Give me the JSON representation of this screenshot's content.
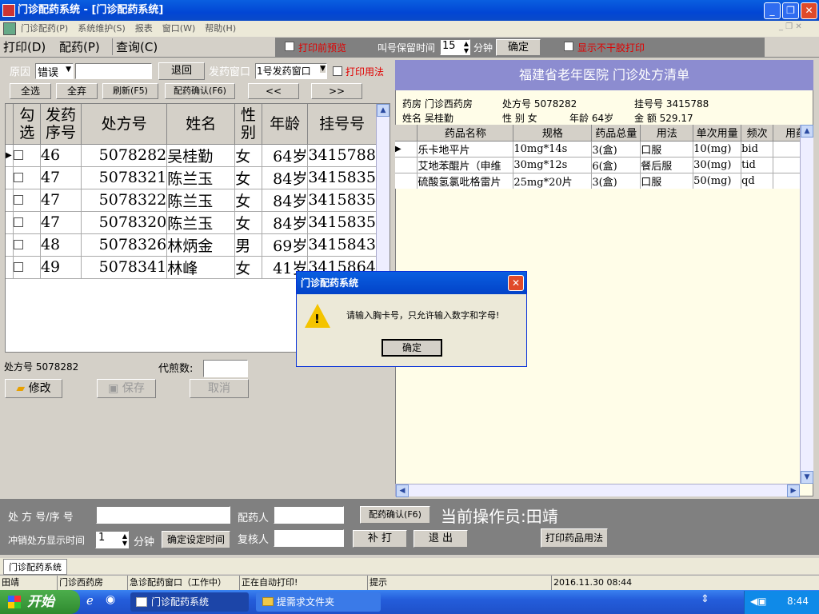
{
  "window": {
    "title": "门诊配药系统 - [门诊配药系统]"
  },
  "menu": [
    "门诊配药(P)",
    "系统维护(S)",
    "报表",
    "窗口(W)",
    "帮助(H)"
  ],
  "tabs": [
    "打印(D)",
    "配药(P)",
    "查询(C)"
  ],
  "toolbar": {
    "print_preview": "打印前预览",
    "hold_label": "叫号保留时间",
    "hold_value": "15",
    "hold_unit": "分钟",
    "confirm": "确定",
    "show_no_dry": "显示不干胶打印"
  },
  "left": {
    "reason_label": "原因",
    "reason_value": "错误",
    "return_btn": "退回",
    "window_label": "发药窗口",
    "window_value": "1号发药窗口",
    "print_usage": "打印用法",
    "select_all": "全选",
    "deselect_all": "全弃",
    "refresh": "刷新(F5)",
    "confirm_dispense": "配药确认(F6)",
    "prev": "<<",
    "next": ">>",
    "columns": [
      "勾选",
      "发药序号",
      "处方号",
      "姓名",
      "性别",
      "年龄",
      "挂号号"
    ],
    "rows": [
      [
        "46",
        "5078282",
        "吴桂勤",
        "女",
        "64岁",
        "3415788"
      ],
      [
        "47",
        "5078321",
        "陈兰玉",
        "女",
        "84岁",
        "3415835"
      ],
      [
        "47",
        "5078322",
        "陈兰玉",
        "女",
        "84岁",
        "3415835"
      ],
      [
        "47",
        "5078320",
        "陈兰玉",
        "女",
        "84岁",
        "3415835"
      ],
      [
        "48",
        "5078326",
        "林炳金",
        "男",
        "69岁",
        "3415843"
      ],
      [
        "49",
        "5078341",
        "林峰",
        "女",
        "41岁",
        "3415864"
      ]
    ],
    "rx_label": "处方号",
    "rx_value": "5078282",
    "decoct_label": "代煎数:",
    "modify": "修改",
    "save": "保存",
    "cancel": "取消"
  },
  "right": {
    "header_title": "福建省老年医院  门诊处方清单",
    "pharmacy": "药房 门诊西药房",
    "rx_no": "处方号 5078282",
    "reg_no": "挂号号 3415788",
    "name": "姓名 吴桂勤",
    "sex": "性  别 女",
    "age": "年龄  64岁",
    "amount": "金  额 529.17",
    "columns": [
      "药品名称",
      "规格",
      "药品总量",
      "用法",
      "单次用量",
      "频次",
      "用药"
    ],
    "rows": [
      [
        "乐卡地平片",
        "10mg*14s",
        "3(盒)",
        "口服",
        "10(mg)",
        "bid"
      ],
      [
        "艾地苯醌片（申维",
        "30mg*12s",
        "6(盒)",
        "餐后服",
        "30(mg)",
        "tid"
      ],
      [
        "硫酸氢氯吡格雷片",
        "25mg*20片",
        "3(盒)",
        "口服",
        "50(mg)",
        "qd"
      ]
    ]
  },
  "bottom": {
    "rx_seq_label": "处 方 号/序  号",
    "dispenser_label": "配药人",
    "confirm_btn": "配药确认(F6)",
    "operator": "当前操作员:田靖",
    "refund_label": "冲销处方显示时间",
    "refund_value": "1",
    "refund_unit": "分钟",
    "set_time_btn": "确定设定时间",
    "checker_label": "复核人",
    "reprint_btn": "补  打",
    "exit_btn": "退  出",
    "print_usage_btn": "打印药品用法"
  },
  "mdi_tab": "门诊配药系统",
  "status": [
    "田靖",
    "门诊西药房",
    "急诊配药窗口（工作中）",
    "正在自动打印!",
    "提示",
    "2016.11.30 08:44"
  ],
  "dialog": {
    "title": "门诊配药系统",
    "message": "请输入胸卡号，只允许输入数字和字母!",
    "ok": "确定"
  },
  "taskbar": {
    "start": "开始",
    "tasks": [
      "门诊配药系统",
      "提需求文件夹"
    ],
    "clock": "8:44"
  }
}
